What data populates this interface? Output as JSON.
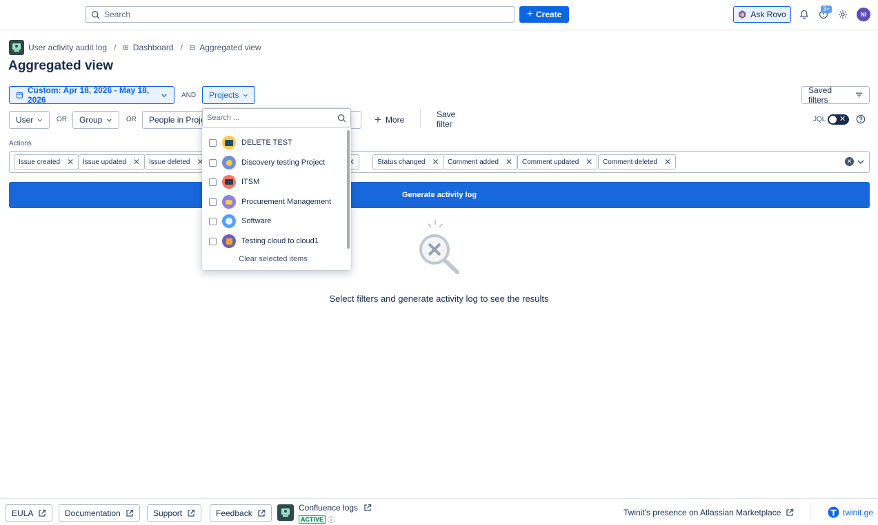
{
  "header": {
    "search_placeholder": "Search",
    "create_label": "Create",
    "ask_rovo_label": "Ask Rovo",
    "notification_badge": "3+",
    "avatar_initials": "NI"
  },
  "breadcrumb": {
    "items": [
      "User activity audit log",
      "Dashboard",
      "Aggregated view"
    ],
    "separator": "/"
  },
  "page_title": "Aggregated view",
  "filters": {
    "date_range": "Custom: Apr 18, 2026 - May 18, 2026",
    "and_label": "AND",
    "projects_label": "Projects",
    "saved_filters_label": "Saved filters",
    "user_label": "User",
    "or_label_1": "OR",
    "group_label": "Group",
    "or_label_2": "OR",
    "people_label": "People in Proje",
    "more_label": "More",
    "save_filter_label": "Save filter",
    "jql_label": "JQL"
  },
  "actions": {
    "label": "Actions",
    "chips": [
      "Issue created",
      "Issue updated",
      "Issue deleted",
      "",
      "Status changed",
      "Comment added",
      "Comment updated",
      "Comment deleted"
    ]
  },
  "generate_label": "Generate activity log",
  "empty_state_text": "Select filters and generate activity log to see the results",
  "projects_dropdown": {
    "search_placeholder": "Search ...",
    "items": [
      "DELETE TEST",
      "Discovery testing Project",
      "ITSM",
      "Procurement Management",
      "Software",
      "Testing cloud to cloud1"
    ],
    "clear_label": "Clear selected items"
  },
  "footer": {
    "eula": "EULA",
    "documentation": "Documentation",
    "support": "Support",
    "feedback": "Feedback",
    "confluence_logs": "Confluence logs",
    "active_badge": "ACTIVE",
    "marketplace": "Twinit's presence on Atlassian Marketplace",
    "brand": "twinit.ge"
  },
  "colors": {
    "primary": "#0c66e4",
    "generate_bg": "#1868db",
    "text": "#172b4d"
  }
}
